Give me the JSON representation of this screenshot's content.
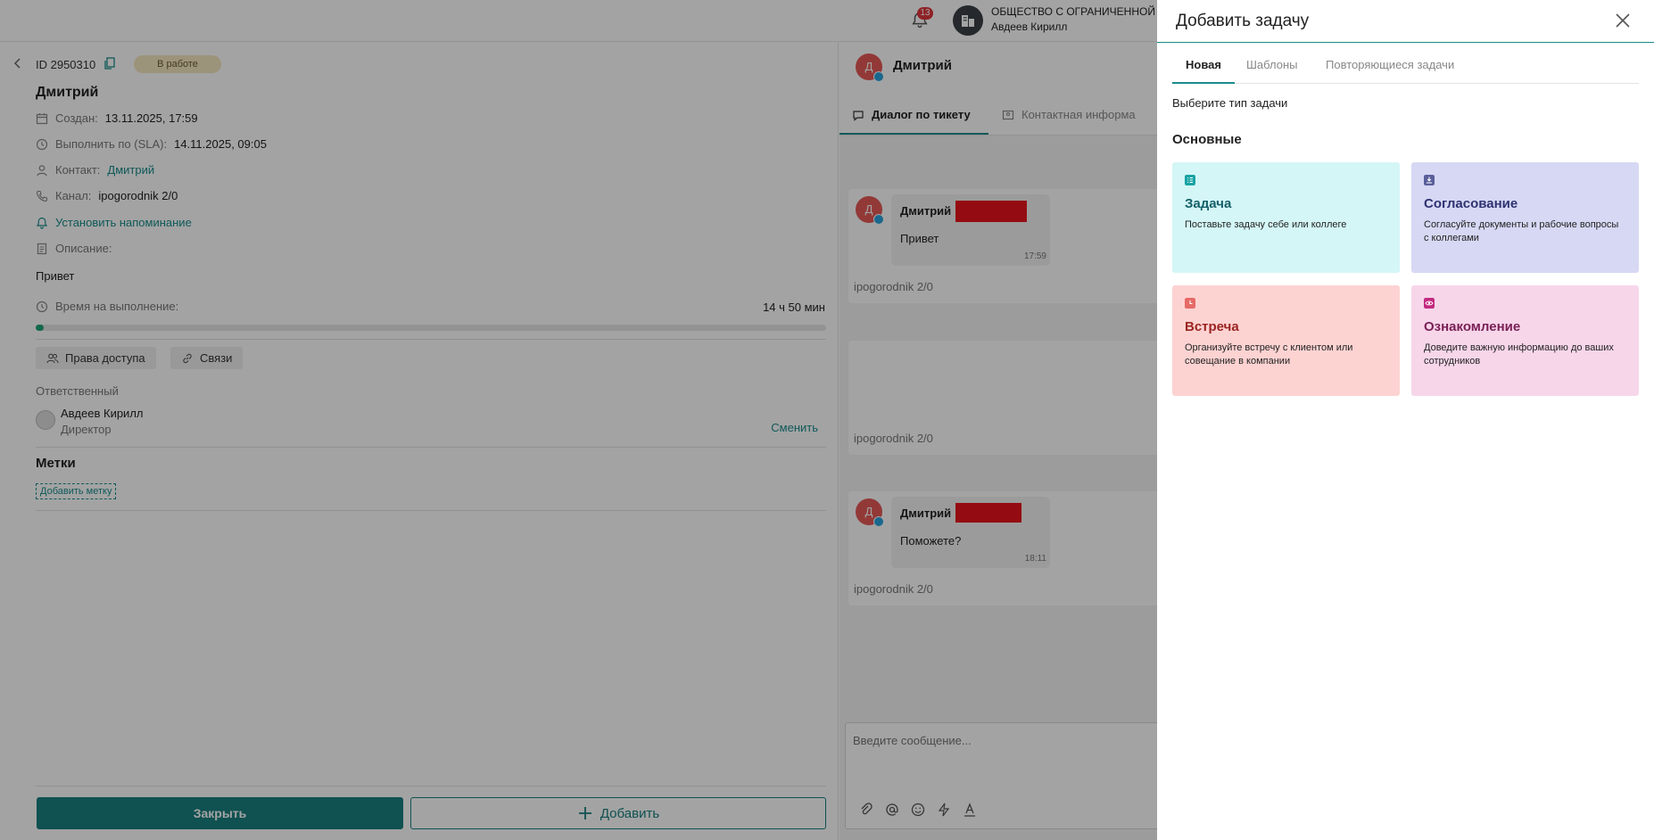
{
  "header": {
    "notifications_count": "13",
    "org_name": "ОБЩЕСТВО С ОГРАНИЧЕННОЙ ОТВ",
    "user_name": "Авдеев Кирилл"
  },
  "ticket": {
    "id": "ID 2950310",
    "status": "В работе",
    "title": "Дмитрий",
    "created_label": "Создан:",
    "created_value": "13.11.2025, 17:59",
    "due_label": "Выполнить по (SLA):",
    "due_value": "14.11.2025, 09:05",
    "contact_label": "Контакт:",
    "contact_value": "Дмитрий",
    "channel_label": "Канал:",
    "channel_value": "ipogorodnik 2/0",
    "reminder_link": "Установить напоминание",
    "description_label": "Описание:",
    "description_value": "Привет",
    "exec_time_label": "Время на выполнение:",
    "exec_time_value": "14 ч 50 мин",
    "exec_progress": 0.01,
    "access_button": "Права доступа",
    "links_button": "Связи",
    "responsible_label": "Ответственный",
    "responsible_name": "Авдеев Кирилл",
    "responsible_role": "Директор",
    "change_link": "Сменить",
    "labels_title": "Метки",
    "add_label": "Добавить метку",
    "close_button": "Закрыть",
    "add_button": "Добавить"
  },
  "chat": {
    "contact_initial": "Д",
    "contact_name": "Дмитрий",
    "tab_dialog": "Диалог по тикету",
    "tab_contact": "Контактная информа",
    "messages": [
      {
        "author": "Дмитрий",
        "text": "Привет",
        "time": "17:59",
        "channel": "ipogorodnik 2/0"
      },
      {
        "channel": "ipogorodnik 2/0"
      },
      {
        "author": "Дмитрий",
        "text": "Поможете?",
        "time": "18:11",
        "channel": "ipogorodnik 2/0"
      }
    ],
    "compose_placeholder": "Введите сообщение..."
  },
  "drawer": {
    "title": "Добавить задачу",
    "tabs": [
      "Новая",
      "Шаблоны",
      "Повторяющиеся задачи"
    ],
    "choose_type": "Выберите тип задачи",
    "section": "Основные",
    "cards": [
      {
        "title": "Задача",
        "desc": "Поставьте задачу себе или коллеге",
        "icon": "list-icon",
        "bg": "#d4f6f6",
        "accent": "#1aa3a3",
        "title_color": "#16606a"
      },
      {
        "title": "Согласование",
        "desc": "Согласуйте документы и рабочие вопросы с коллегами",
        "icon": "approve-icon",
        "bg": "#d6d8f4",
        "accent": "#5a5f9a",
        "title_color": "#2e3270"
      },
      {
        "title": "Встреча",
        "desc": "Организуйте встречу с клиентом или совещание в компании",
        "icon": "clock-icon",
        "bg": "#fdd3d2",
        "accent": "#e56a66",
        "title_color": "#9a2421"
      },
      {
        "title": "Ознакомление",
        "desc": "Доведите важную информацию до ваших сотрудников",
        "icon": "eye-icon",
        "bg": "#f7d6ea",
        "accent": "#c22a80",
        "title_color": "#7a1f55"
      }
    ]
  }
}
